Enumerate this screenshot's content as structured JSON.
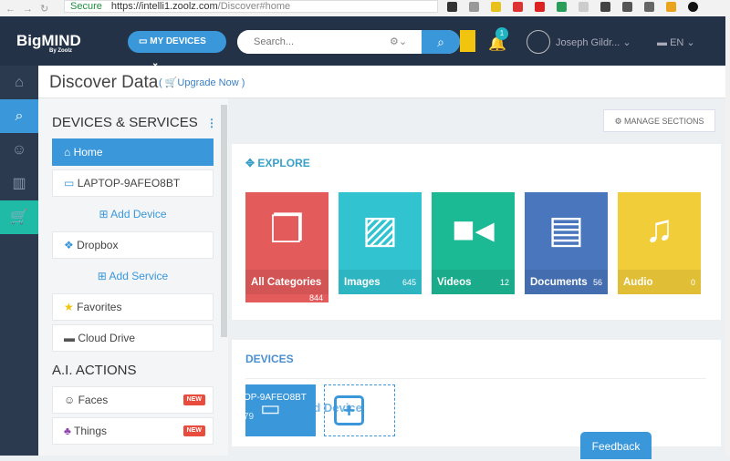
{
  "browser": {
    "secure": "Secure",
    "url_host": "https://intelli1.zoolz.com",
    "url_path": "/Discover#home"
  },
  "topbar": {
    "logo": "BigMIND",
    "logo_sub": "By Zoolz",
    "my_devices": "MY DEVICES",
    "search_placeholder": "Search...",
    "notif_count": "1",
    "user": "Joseph Gildr...",
    "lang": "EN"
  },
  "page": {
    "title": "Discover Data",
    "upgrade": "Upgrade Now"
  },
  "left": {
    "devices_title": "DEVICES & SERVICES",
    "home": "Home",
    "laptop": "LAPTOP-9AFEO8BT",
    "add_device": "Add Device",
    "dropbox": "Dropbox",
    "add_service": "Add Service",
    "favorites": "Favorites",
    "cloud_drive": "Cloud Drive",
    "ai_title": "A.I. ACTIONS",
    "faces": "Faces",
    "things": "Things",
    "new_badge": "NEW"
  },
  "main": {
    "manage": "MANAGE SECTIONS",
    "explore": "EXPLORE",
    "tiles": [
      {
        "label": "All Categories",
        "count": "844",
        "color": "#e35b5b"
      },
      {
        "label": "Images",
        "count": "645",
        "color": "#32c3d1"
      },
      {
        "label": "Videos",
        "count": "12",
        "color": "#1cb995"
      },
      {
        "label": "Documents",
        "count": "56",
        "color": "#4a76bd"
      },
      {
        "label": "Audio",
        "count": "0",
        "color": "#f2cd3a"
      }
    ],
    "devices": "DEVICES",
    "device_name": "OP-9AFEO8BT",
    "device_size": "79",
    "add_device": "Add Device"
  },
  "feedback": "Feedback"
}
